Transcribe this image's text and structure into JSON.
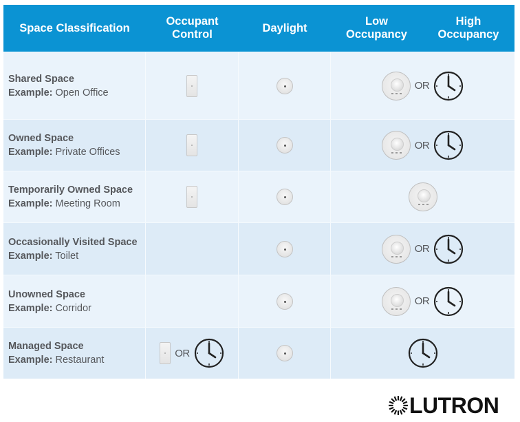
{
  "table": {
    "header": {
      "space_classification": "Space Classification",
      "occupant_control": "Occupant\nControl",
      "daylight": "Daylight",
      "low_occupancy": "Low\nOccupancy",
      "high_occupancy": "High\nOccupancy"
    },
    "example_label": "Example:",
    "or_label": "OR",
    "rows": [
      {
        "name": "Shared Space",
        "example": "Open Office",
        "occupant_control": [
          "wall-switch"
        ],
        "daylight": "daylight-sensor",
        "occupancy": [
          "occupancy-sensor",
          "time-clock"
        ]
      },
      {
        "name": "Owned Space",
        "example": "Private Offices",
        "occupant_control": [
          "wall-switch"
        ],
        "daylight": "daylight-sensor",
        "occupancy": [
          "occupancy-sensor",
          "time-clock"
        ]
      },
      {
        "name": "Temporarily Owned Space",
        "example": "Meeting Room",
        "occupant_control": [
          "wall-switch"
        ],
        "daylight": "daylight-sensor",
        "occupancy": [
          "occupancy-sensor"
        ]
      },
      {
        "name": "Occasionally Visited Space",
        "example": "Toilet",
        "occupant_control": [],
        "daylight": "daylight-sensor",
        "occupancy": [
          "occupancy-sensor",
          "time-clock"
        ]
      },
      {
        "name": "Unowned Space",
        "example": "Corridor",
        "occupant_control": [],
        "daylight": "daylight-sensor",
        "occupancy": [
          "occupancy-sensor",
          "time-clock"
        ]
      },
      {
        "name": "Managed Space",
        "example": "Restaurant",
        "occupant_control": [
          "wall-switch",
          "time-clock"
        ],
        "daylight": "daylight-sensor",
        "occupancy": [
          "time-clock"
        ]
      }
    ]
  },
  "colors": {
    "header_bg": "#0B93D3",
    "row_odd": "#EAF3FB",
    "row_even": "#DDEBF7",
    "text": "#55575B"
  },
  "brand": {
    "logo_text": "LUTRON"
  }
}
